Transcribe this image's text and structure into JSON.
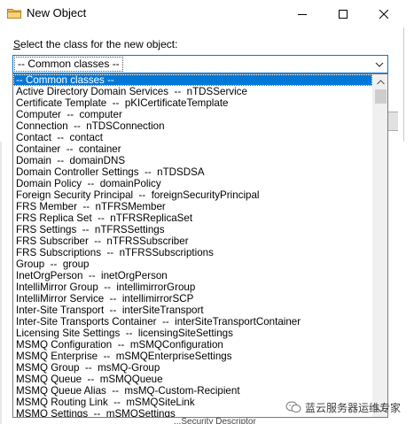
{
  "window": {
    "title": "New Object",
    "minimize_glyph": "—",
    "close_glyph": "✕"
  },
  "prompt": {
    "accel": "S",
    "rest": "elect the class for the new object:"
  },
  "combo": {
    "value": "-- Common classes --"
  },
  "list": {
    "selected_index": 0,
    "items": [
      "-- Common classes --",
      "Active Directory Domain Services  --  nTDSService",
      "Certificate Template  --  pKICertificateTemplate",
      "Computer  --  computer",
      "Connection  --  nTDSConnection",
      "Contact  --  contact",
      "Container  --  container",
      "Domain  --  domainDNS",
      "Domain Controller Settings  --  nTDSDSA",
      "Domain Policy  --  domainPolicy",
      "Foreign Security Principal  --  foreignSecurityPrincipal",
      "FRS Member  --  nTFRSMember",
      "FRS Replica Set  --  nTFRSReplicaSet",
      "FRS Settings  --  nTFRSSettings",
      "FRS Subscriber  --  nTFRSSubscriber",
      "FRS Subscriptions  --  nTFRSSubscriptions",
      "Group  --  group",
      "InetOrgPerson  --  inetOrgPerson",
      "IntelliMirror Group  --  intellimirrorGroup",
      "IntelliMirror Service  --  intellimirrorSCP",
      "Inter-Site Transport  --  interSiteTransport",
      "Inter-Site Transports Container  --  interSiteTransportContainer",
      "Licensing Site Settings  --  licensingSiteSettings",
      "MSMQ Configuration  --  mSMQConfiguration",
      "MSMQ Enterprise  --  mSMQEnterpriseSettings",
      "MSMQ Group  --  msMQ-Group",
      "MSMQ Queue  --  mSMQQueue",
      "MSMQ Queue Alias  --  msMQ-Custom-Recipient",
      "MSMQ Routing Link  --  mSMQSiteLink",
      "MSMQ Settings  --  mSMQSettings"
    ]
  },
  "watermark": {
    "text": "蓝云服务器运维专家"
  },
  "background": {
    "partial_text": "...Security Descriptor"
  },
  "colors": {
    "selection": "#0078d7",
    "combo_border": "#0078d7",
    "scroll_track": "#f0f0f0",
    "scroll_thumb": "#cdcdcd"
  }
}
